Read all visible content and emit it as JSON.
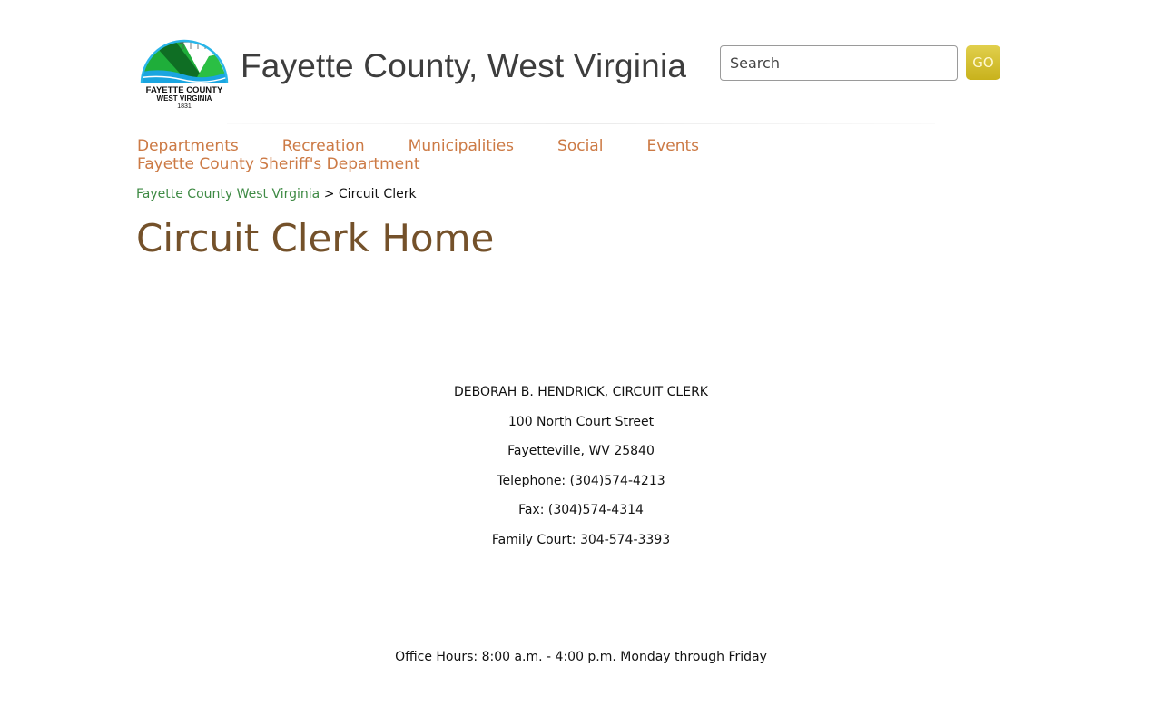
{
  "header": {
    "site_title": "Fayette County, West Virginia",
    "logo": {
      "line1": "FAYETTE COUNTY",
      "line2": "WEST VIRGINIA",
      "line3": "1831"
    },
    "search": {
      "placeholder": "Search",
      "value": "",
      "go_label": "GO"
    }
  },
  "nav": {
    "items": [
      "Departments",
      "Recreation",
      "Municipalities",
      "Social",
      "Events",
      "Fayette County Sheriff's Department"
    ]
  },
  "breadcrumb": {
    "home": "Fayette County West Virginia",
    "separator": ">",
    "current": "Circuit Clerk"
  },
  "page": {
    "title": "Circuit Clerk Home",
    "contact": [
      "DEBORAH B. HENDRICK, CIRCUIT CLERK",
      "100 North Court Street",
      "Fayetteville, WV  25840",
      "Telephone:  (304)574-4213",
      "Fax:  (304)574-4314",
      "Family Court: 304-574-3393"
    ],
    "office_hours": "Office Hours:  8:00 a.m. - 4:00 p.m. Monday through Friday"
  },
  "colors": {
    "nav_link": "#cc7a45",
    "breadcrumb_link": "#3e8a44",
    "page_title": "#74512a",
    "go_button": "#d4c031"
  }
}
